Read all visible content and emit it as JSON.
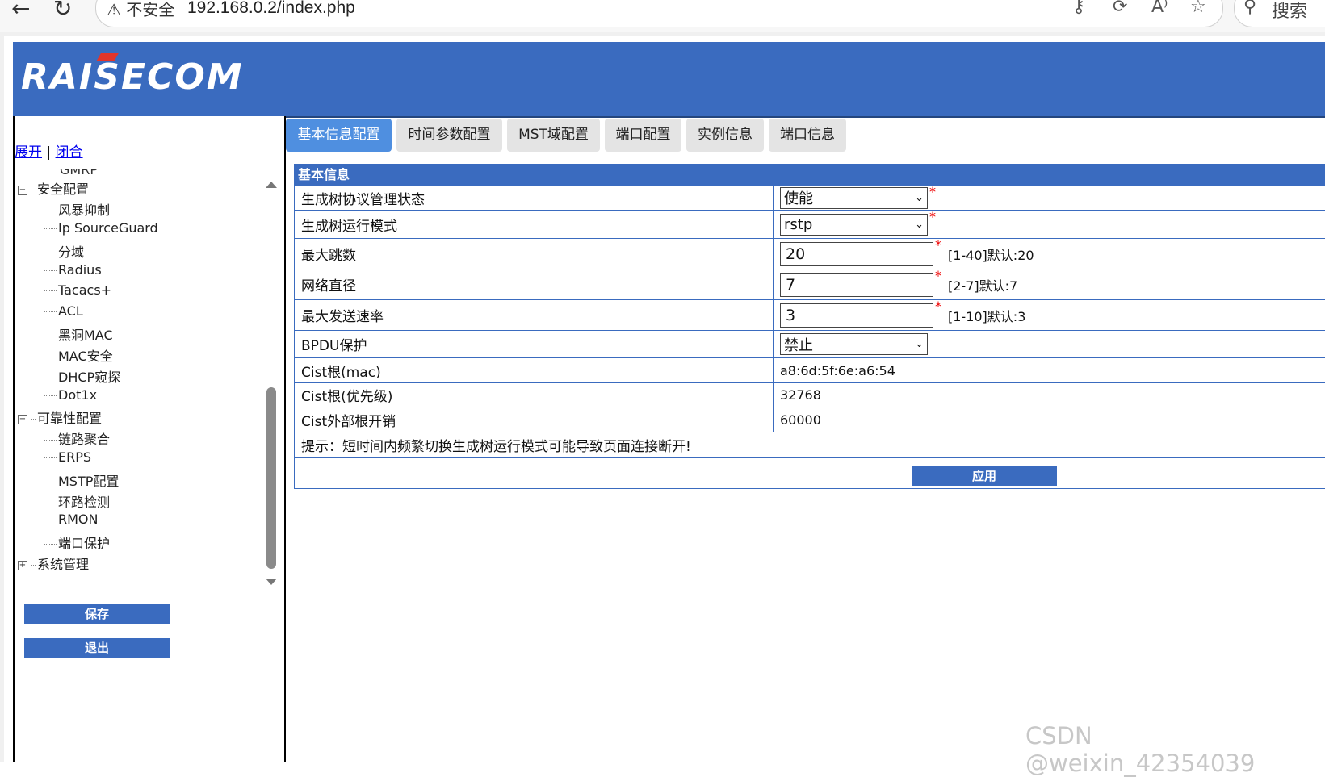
{
  "browser": {
    "security_warning": "不安全",
    "url": "192.168.0.2/index.php",
    "search_label": "搜索"
  },
  "header": {
    "logo_text": "RAISECOM"
  },
  "sidebar": {
    "expand_label": "展开",
    "separator": "|",
    "collapse_label": "闭合",
    "partial_item": "GMRP",
    "groups": [
      {
        "label": "安全配置",
        "toggle": "−",
        "items": [
          "风暴抑制",
          "Ip SourceGuard",
          "分域",
          "Radius",
          "Tacacs+",
          "ACL",
          "黑洞MAC",
          "MAC安全",
          "DHCP窥探",
          "Dot1x"
        ]
      },
      {
        "label": "可靠性配置",
        "toggle": "−",
        "items": [
          "链路聚合",
          "ERPS",
          "MSTP配置",
          "环路检测",
          "RMON",
          "端口保护"
        ]
      },
      {
        "label": "系统管理",
        "toggle": "+",
        "items": []
      }
    ],
    "save_label": "保存",
    "logout_label": "退出"
  },
  "tabs": [
    "基本信息配置",
    "时间参数配置",
    "MST域配置",
    "端口配置",
    "实例信息",
    "端口信息"
  ],
  "table": {
    "title": "基本信息",
    "rows": [
      {
        "label": "生成树协议管理状态",
        "type": "select",
        "value": "使能",
        "required": "*"
      },
      {
        "label": "生成树运行模式",
        "type": "select",
        "value": "rstp",
        "required": "*"
      },
      {
        "label": "最大跳数",
        "type": "input",
        "value": "20",
        "required": "*",
        "hint": "[1-40]默认:20"
      },
      {
        "label": "网络直径",
        "type": "input",
        "value": "7",
        "required": "*",
        "hint": "[2-7]默认:7"
      },
      {
        "label": "最大发送速率",
        "type": "input",
        "value": "3",
        "required": "*",
        "hint": "[1-10]默认:3"
      },
      {
        "label": "BPDU保护",
        "type": "select",
        "value": "禁止"
      },
      {
        "label": "Cist根(mac)",
        "type": "text",
        "value": "a8:6d:5f:6e:a6:54"
      },
      {
        "label": "Cist根(优先级)",
        "type": "text",
        "value": "32768"
      },
      {
        "label": "Cist外部根开销",
        "type": "text",
        "value": "60000"
      }
    ],
    "notice": "提示：短时间内频繁切换生成树运行模式可能导致页面连接断开!",
    "apply_label": "应用"
  },
  "watermark": "CSDN @weixin_42354039"
}
